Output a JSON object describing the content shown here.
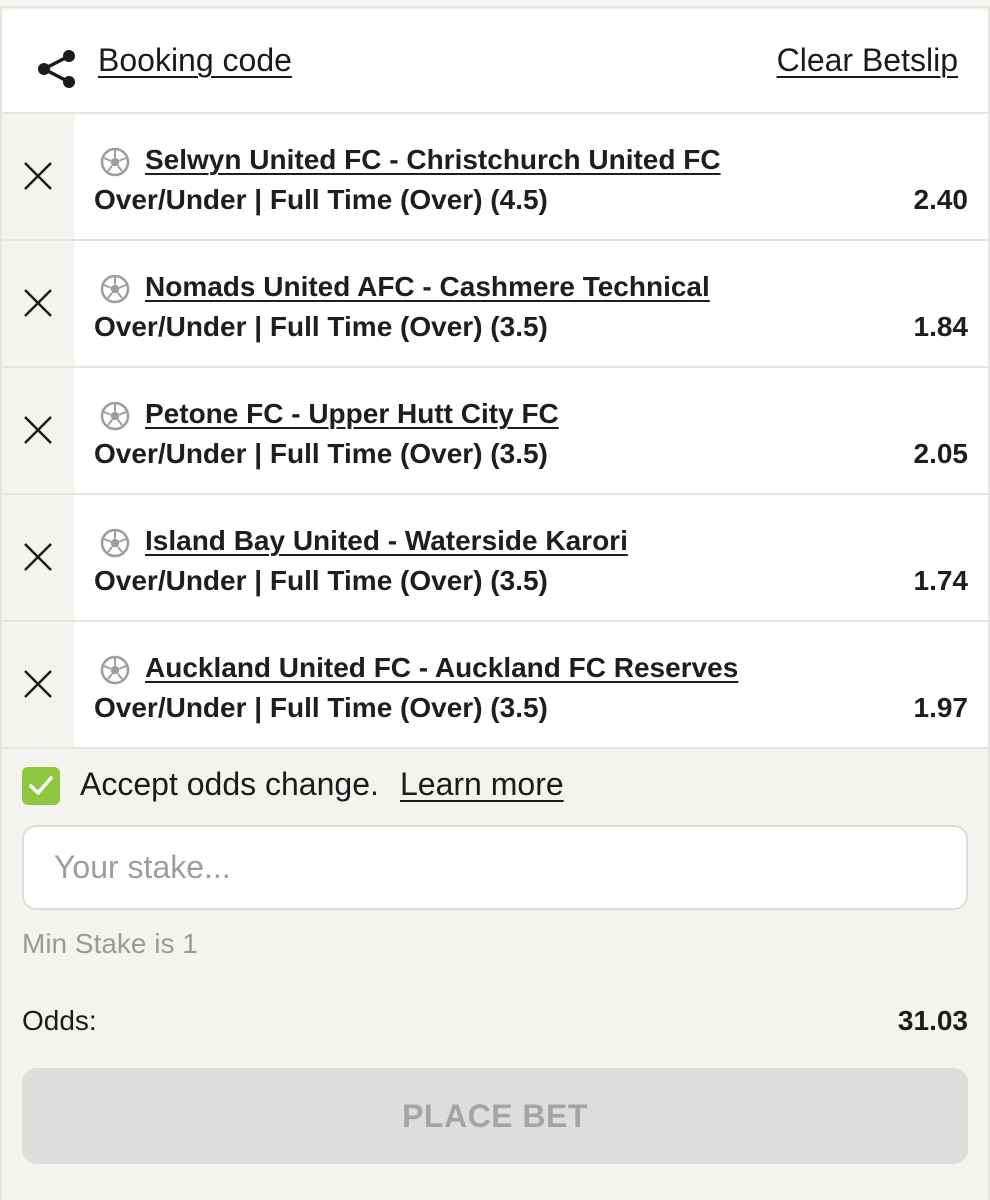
{
  "header": {
    "share_icon": "share-icon",
    "booking_code_label": "Booking code",
    "clear_betslip_label": "Clear Betslip"
  },
  "selections": [
    {
      "match": "Selwyn United FC - Christchurch United FC",
      "market": "Over/Under | Full Time (Over) (4.5)",
      "odds": "2.40",
      "sport_icon": "soccer-ball-icon",
      "remove_icon": "close-icon"
    },
    {
      "match": "Nomads United AFC - Cashmere Technical",
      "market": "Over/Under | Full Time (Over) (3.5)",
      "odds": "1.84",
      "sport_icon": "soccer-ball-icon",
      "remove_icon": "close-icon"
    },
    {
      "match": "Petone FC - Upper Hutt City FC",
      "market": "Over/Under | Full Time (Over) (3.5)",
      "odds": "2.05",
      "sport_icon": "soccer-ball-icon",
      "remove_icon": "close-icon"
    },
    {
      "match": "Island Bay United - Waterside Karori",
      "market": "Over/Under | Full Time (Over) (3.5)",
      "odds": "1.74",
      "sport_icon": "soccer-ball-icon",
      "remove_icon": "close-icon"
    },
    {
      "match": "Auckland United FC - Auckland FC Reserves",
      "market": "Over/Under | Full Time (Over) (3.5)",
      "odds": "1.97",
      "sport_icon": "soccer-ball-icon",
      "remove_icon": "close-icon"
    }
  ],
  "accept_odds": {
    "checked": true,
    "label": "Accept odds change.",
    "learn_more": "Learn more",
    "check_color": "#8dc63f"
  },
  "stake": {
    "value": "",
    "placeholder": "Your stake...",
    "min_stake_text": "Min Stake is 1"
  },
  "summary": {
    "odds_label": "Odds:",
    "odds_value": "31.03"
  },
  "place_bet": {
    "label": "PLACE BET",
    "enabled": false
  }
}
